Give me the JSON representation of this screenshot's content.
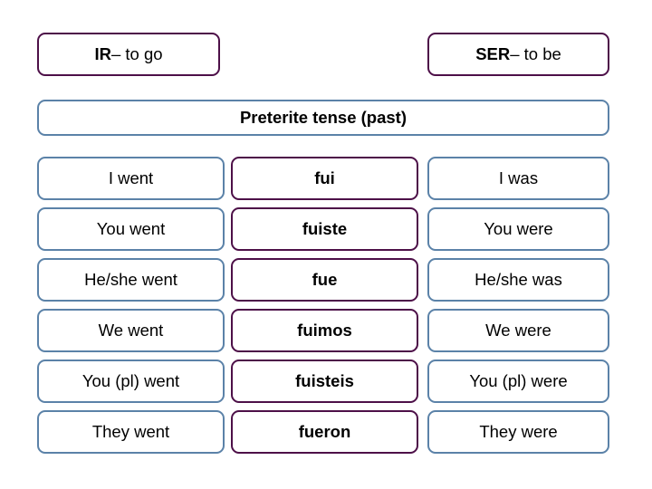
{
  "colors": {
    "purple_border": "#4D1048",
    "blue_border": "#5B82A8",
    "background": "#FFFFFF",
    "text": "#000000"
  },
  "header": {
    "ir_box": {
      "lemma": "IR",
      "gloss": " – to go",
      "full_text": "IR – to go"
    },
    "ser_box": {
      "lemma": "SER",
      "gloss": " – to be",
      "full_text": "SER – to be"
    }
  },
  "tense": {
    "title": "Preterite tense (past)"
  },
  "table": {
    "columns": [
      "ir_english",
      "spanish",
      "ser_english"
    ],
    "rows": [
      {
        "ir_english": "I went",
        "spanish": "fui",
        "ser_english": "I was"
      },
      {
        "ir_english": "You went",
        "spanish": "fuiste",
        "ser_english": "You were"
      },
      {
        "ir_english": "He/she went",
        "spanish": "fue",
        "ser_english": "He/she was"
      },
      {
        "ir_english": "We went",
        "spanish": "fuimos",
        "ser_english": "We were"
      },
      {
        "ir_english": "You (pl) went",
        "spanish": "fuisteis",
        "ser_english": "You (pl) were"
      },
      {
        "ir_english": "They went",
        "spanish": "fueron",
        "ser_english": "They were"
      }
    ]
  }
}
